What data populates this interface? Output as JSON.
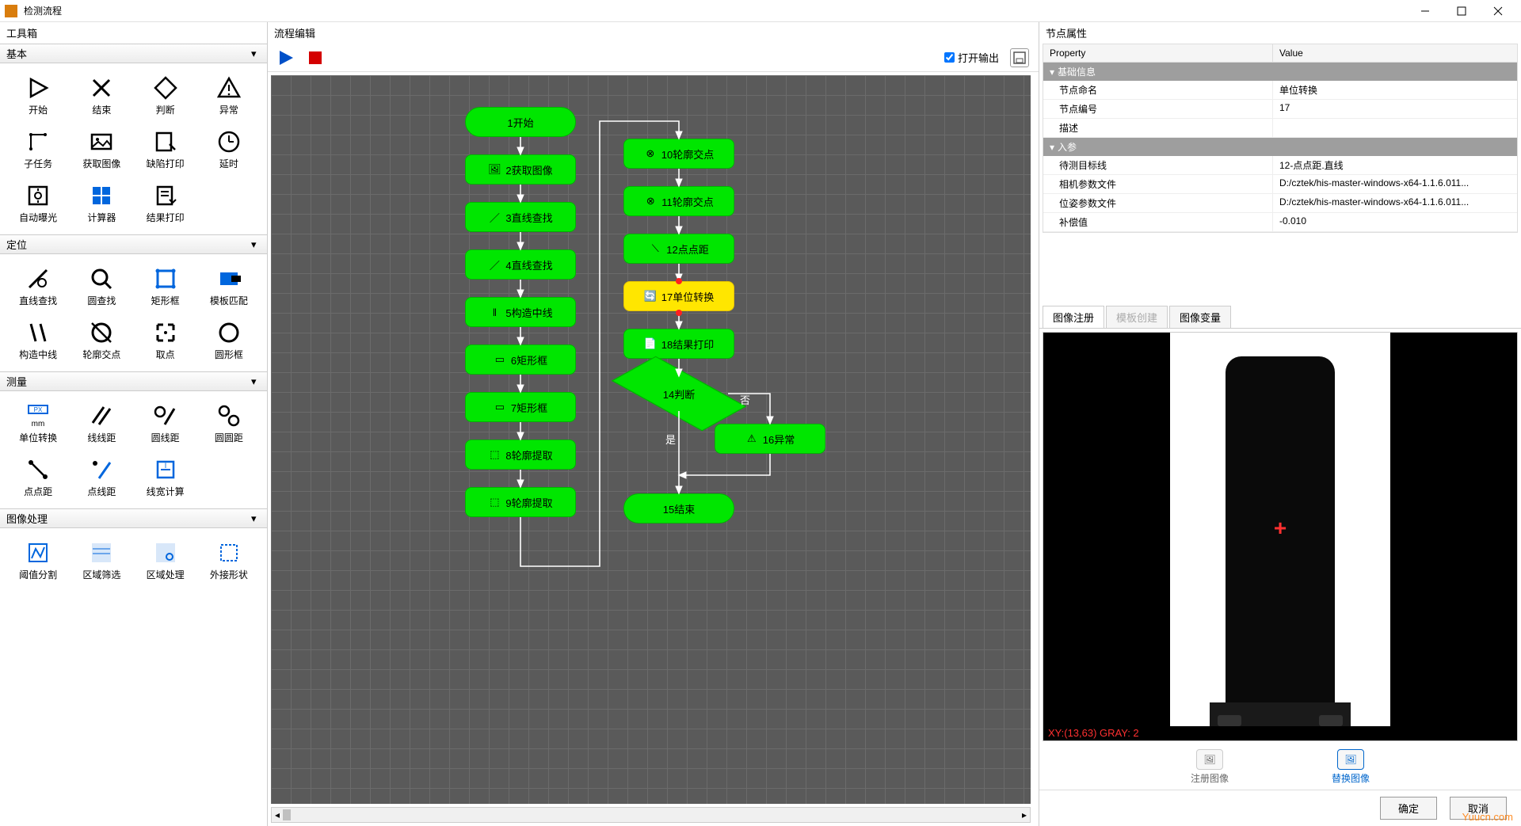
{
  "window": {
    "title": "检测流程"
  },
  "toolbox": {
    "title": "工具箱",
    "sections": {
      "basic": {
        "label": "基本",
        "items": [
          "开始",
          "结束",
          "判断",
          "异常",
          "子任务",
          "获取图像",
          "缺陷打印",
          "延时",
          "自动曝光",
          "计算器",
          "结果打印"
        ]
      },
      "locate": {
        "label": "定位",
        "items": [
          "直线查找",
          "圆查找",
          "矩形框",
          "模板匹配",
          "构造中线",
          "轮廓交点",
          "取点",
          "圆形框"
        ]
      },
      "measure": {
        "label": "测量",
        "items": [
          "单位转换",
          "线线距",
          "圆线距",
          "圆圆距",
          "点点距",
          "点线距",
          "线宽计算"
        ]
      },
      "imgproc": {
        "label": "图像处理",
        "items": [
          "阈值分割",
          "区域筛选",
          "区域处理",
          "外接形状"
        ]
      }
    }
  },
  "editor": {
    "title": "流程编辑",
    "open_output": "打开输出",
    "labels": {
      "yes": "是",
      "no": "否"
    },
    "nodes": {
      "n1": "1开始",
      "n2": "2获取图像",
      "n3": "3直线查找",
      "n4": "4直线查找",
      "n5": "5构造中线",
      "n6": "6矩形框",
      "n7": "7矩形框",
      "n8": "8轮廓提取",
      "n9": "9轮廓提取",
      "n10": "10轮廓交点",
      "n11": "11轮廓交点",
      "n12": "12点点距",
      "n13": "17单位转换",
      "n14": "18结果打印",
      "n15": "14判断",
      "n16": "16异常",
      "n17": "15结束"
    }
  },
  "props": {
    "title": "节点属性",
    "cols": {
      "prop": "Property",
      "val": "Value"
    },
    "groups": {
      "basic": "基础信息",
      "inparam": "入参"
    },
    "rows": {
      "name_k": "节点命名",
      "name_v": "单位转换",
      "id_k": "节点编号",
      "id_v": "17",
      "desc_k": "描述",
      "desc_v": "",
      "target_k": "待测目标线",
      "target_v": "12-点点距.直线",
      "cam_k": "相机参数文件",
      "cam_v": "D:/cztek/his-master-windows-x64-1.1.6.011...",
      "pose_k": "位姿参数文件",
      "pose_v": "D:/cztek/his-master-windows-x64-1.1.6.011...",
      "comp_k": "补偿值",
      "comp_v": "-0.010"
    }
  },
  "image": {
    "tabs": {
      "register": "图像注册",
      "template": "模板创建",
      "variable": "图像变量"
    },
    "info": "XY:(13,63) GRAY: 2",
    "ops": {
      "reg": "注册图像",
      "swap": "替换图像"
    }
  },
  "buttons": {
    "ok": "确定",
    "cancel": "取消"
  },
  "watermark": "Yuucn.com"
}
